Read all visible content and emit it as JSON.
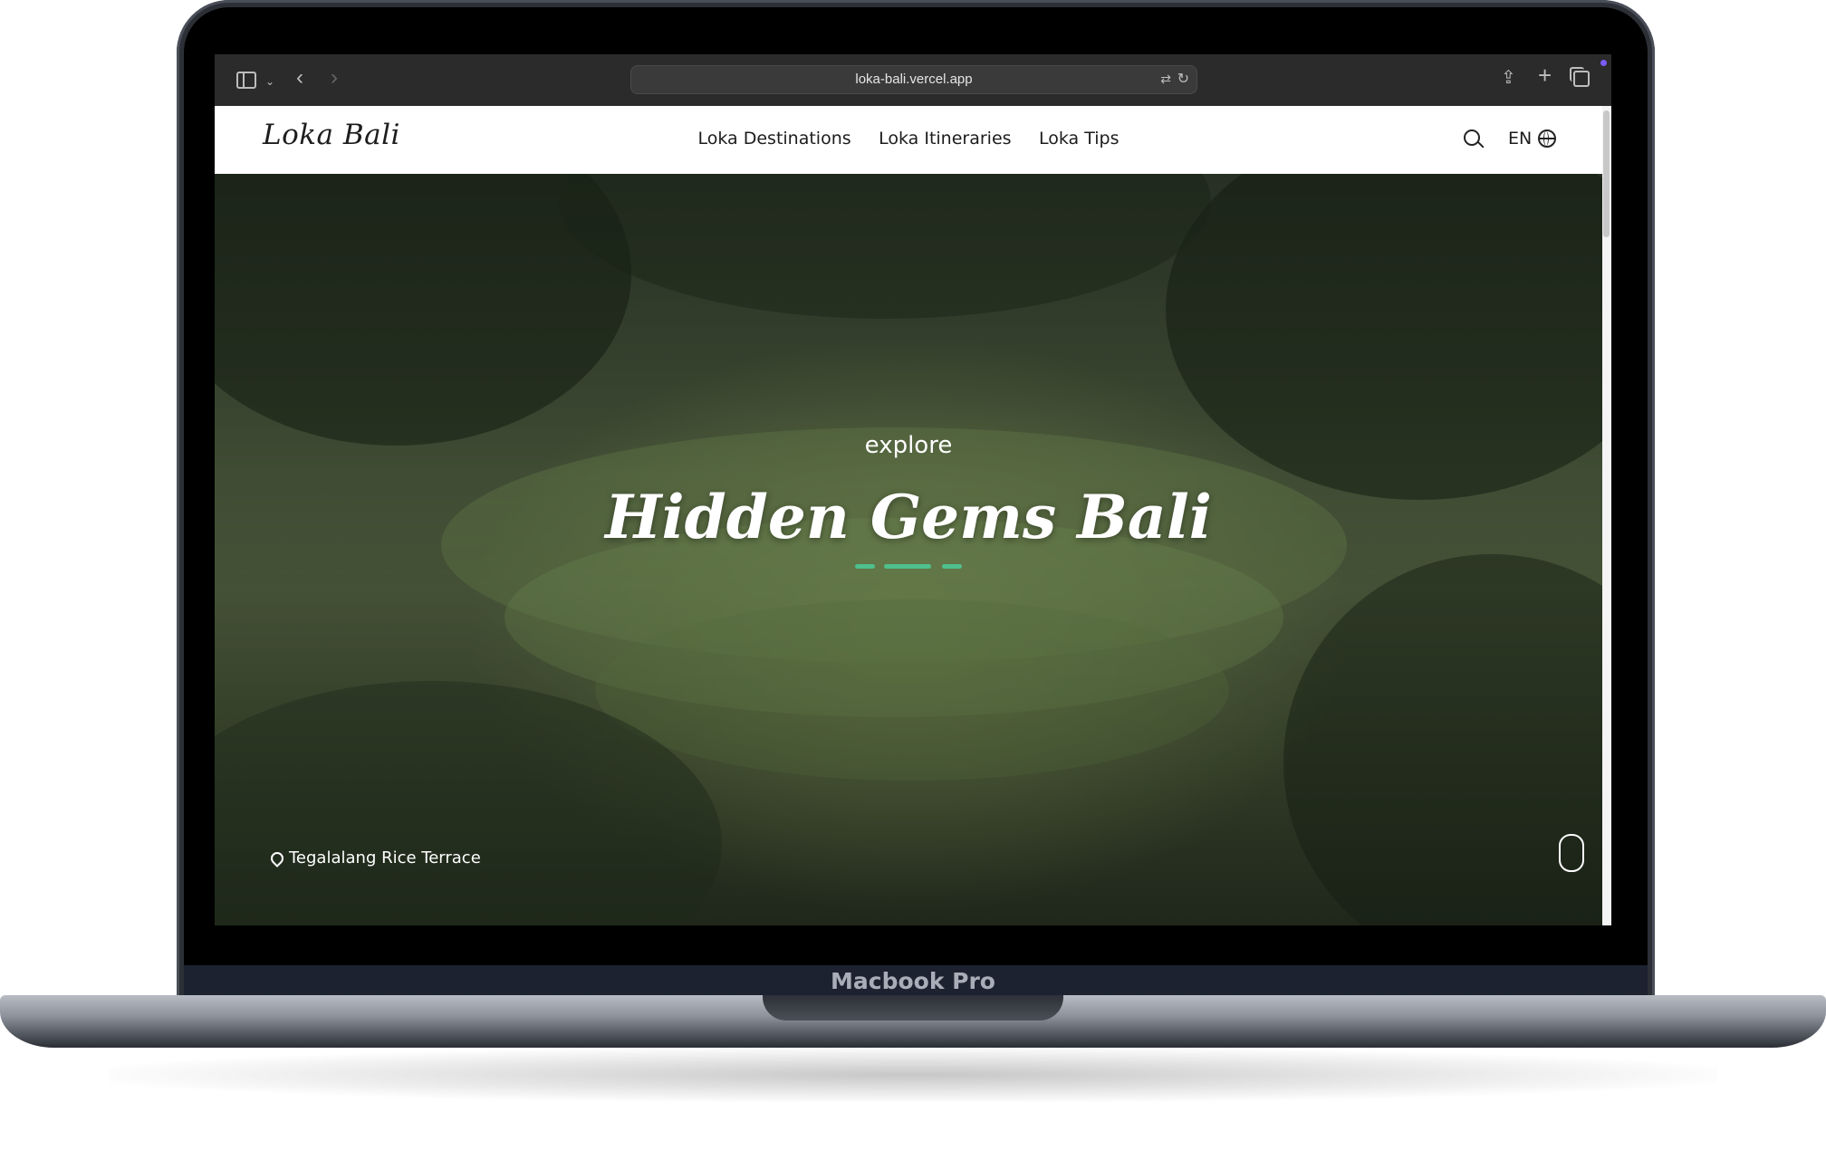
{
  "device": {
    "label": "Macbook Pro"
  },
  "browser": {
    "url": "loka-bali.vercel.app"
  },
  "site": {
    "logo": "Loka Bali",
    "nav": [
      {
        "label": "Loka Destinations"
      },
      {
        "label": "Loka Itineraries"
      },
      {
        "label": "Loka Tips"
      }
    ],
    "language": "EN"
  },
  "hero": {
    "kicker": "explore",
    "title": "Hidden Gems Bali",
    "location": "Tegalalang Rice Terrace",
    "accent_color": "#4fc08d"
  },
  "icons": [
    "sidebar-icon",
    "chevron-down-icon",
    "back-arrow-icon",
    "forward-arrow-icon",
    "translate-icon",
    "reload-icon",
    "share-icon",
    "new-tab-icon",
    "tabs-icon",
    "search-icon",
    "globe-icon",
    "location-pin-icon",
    "scroll-mouse-icon"
  ]
}
